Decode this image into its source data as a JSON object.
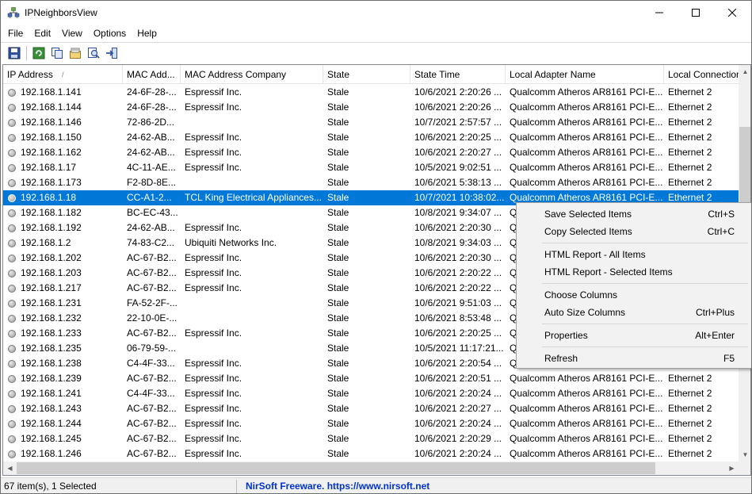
{
  "window": {
    "title": "IPNeighborsView"
  },
  "menu": [
    "File",
    "Edit",
    "View",
    "Options",
    "Help"
  ],
  "toolbar": {
    "buttons": [
      "save-icon",
      "refresh-icon",
      "copy-icon",
      "properties-icon",
      "find-icon",
      "exit-icon"
    ]
  },
  "columns": [
    "IP Address",
    "MAC Add...",
    "MAC Address Company",
    "State",
    "State Time",
    "Local Adapter Name",
    "Local Connection"
  ],
  "sort_indicator": "/",
  "rows": [
    {
      "ip": "192.168.1.141",
      "mac": "24-6F-28-...",
      "company": "Espressif Inc.",
      "state": "Stale",
      "time": "10/6/2021 2:20:26 ...",
      "adapter": "Qualcomm Atheros AR8161 PCI-E...",
      "conn": "Ethernet 2"
    },
    {
      "ip": "192.168.1.144",
      "mac": "24-6F-28-...",
      "company": "Espressif Inc.",
      "state": "Stale",
      "time": "10/6/2021 2:20:26 ...",
      "adapter": "Qualcomm Atheros AR8161 PCI-E...",
      "conn": "Ethernet 2"
    },
    {
      "ip": "192.168.1.146",
      "mac": "72-86-2D...",
      "company": "",
      "state": "Stale",
      "time": "10/7/2021 2:57:57 ...",
      "adapter": "Qualcomm Atheros AR8161 PCI-E...",
      "conn": "Ethernet 2"
    },
    {
      "ip": "192.168.1.150",
      "mac": "24-62-AB...",
      "company": "Espressif Inc.",
      "state": "Stale",
      "time": "10/6/2021 2:20:25 ...",
      "adapter": "Qualcomm Atheros AR8161 PCI-E...",
      "conn": "Ethernet 2"
    },
    {
      "ip": "192.168.1.162",
      "mac": "24-62-AB...",
      "company": "Espressif Inc.",
      "state": "Stale",
      "time": "10/6/2021 2:20:27 ...",
      "adapter": "Qualcomm Atheros AR8161 PCI-E...",
      "conn": "Ethernet 2"
    },
    {
      "ip": "192.168.1.17",
      "mac": "4C-11-AE...",
      "company": "Espressif Inc.",
      "state": "Stale",
      "time": "10/5/2021 9:02:51 ...",
      "adapter": "Qualcomm Atheros AR8161 PCI-E...",
      "conn": "Ethernet 2"
    },
    {
      "ip": "192.168.1.173",
      "mac": "F2-8D-8E...",
      "company": "",
      "state": "Stale",
      "time": "10/6/2021 5:38:13 ...",
      "adapter": "Qualcomm Atheros AR8161 PCI-E...",
      "conn": "Ethernet 2"
    },
    {
      "ip": "192.168.1.18",
      "mac": "CC-A1-2...",
      "company": "TCL King Electrical Appliances...",
      "state": "Stale",
      "time": "10/7/2021 10:38:02...",
      "adapter": "Qualcomm Atheros AR8161 PCI-E...",
      "conn": "Ethernet 2",
      "selected": true
    },
    {
      "ip": "192.168.1.182",
      "mac": "BC-EC-43...",
      "company": "",
      "state": "Stale",
      "time": "10/8/2021 9:34:07 ...",
      "adapter": "Q",
      "conn": ""
    },
    {
      "ip": "192.168.1.192",
      "mac": "24-62-AB...",
      "company": "Espressif Inc.",
      "state": "Stale",
      "time": "10/6/2021 2:20:30 ...",
      "adapter": "Q",
      "conn": ""
    },
    {
      "ip": "192.168.1.2",
      "mac": "74-83-C2...",
      "company": "Ubiquiti Networks Inc.",
      "state": "Stale",
      "time": "10/8/2021 9:34:03 ...",
      "adapter": "Q",
      "conn": ""
    },
    {
      "ip": "192.168.1.202",
      "mac": "AC-67-B2...",
      "company": "Espressif Inc.",
      "state": "Stale",
      "time": "10/6/2021 2:20:30 ...",
      "adapter": "Q",
      "conn": ""
    },
    {
      "ip": "192.168.1.203",
      "mac": "AC-67-B2...",
      "company": "Espressif Inc.",
      "state": "Stale",
      "time": "10/6/2021 2:20:22 ...",
      "adapter": "Q",
      "conn": ""
    },
    {
      "ip": "192.168.1.217",
      "mac": "AC-67-B2...",
      "company": "Espressif Inc.",
      "state": "Stale",
      "time": "10/6/2021 2:20:22 ...",
      "adapter": "Q",
      "conn": ""
    },
    {
      "ip": "192.168.1.231",
      "mac": "FA-52-2F-...",
      "company": "",
      "state": "Stale",
      "time": "10/6/2021 9:51:03 ...",
      "adapter": "Q",
      "conn": ""
    },
    {
      "ip": "192.168.1.232",
      "mac": "22-10-0E-...",
      "company": "",
      "state": "Stale",
      "time": "10/6/2021 8:53:48 ...",
      "adapter": "Q",
      "conn": ""
    },
    {
      "ip": "192.168.1.233",
      "mac": "AC-67-B2...",
      "company": "Espressif Inc.",
      "state": "Stale",
      "time": "10/6/2021 2:20:25 ...",
      "adapter": "Q",
      "conn": ""
    },
    {
      "ip": "192.168.1.235",
      "mac": "06-79-59-...",
      "company": "",
      "state": "Stale",
      "time": "10/5/2021 11:17:21...",
      "adapter": "Q",
      "conn": ""
    },
    {
      "ip": "192.168.1.238",
      "mac": "C4-4F-33...",
      "company": "Espressif Inc.",
      "state": "Stale",
      "time": "10/6/2021 2:20:54 ...",
      "adapter": "Q",
      "conn": ""
    },
    {
      "ip": "192.168.1.239",
      "mac": "AC-67-B2...",
      "company": "Espressif Inc.",
      "state": "Stale",
      "time": "10/6/2021 2:20:51 ...",
      "adapter": "Qualcomm Atheros AR8161 PCI-E...",
      "conn": "Ethernet 2"
    },
    {
      "ip": "192.168.1.241",
      "mac": "C4-4F-33...",
      "company": "Espressif Inc.",
      "state": "Stale",
      "time": "10/6/2021 2:20:24 ...",
      "adapter": "Qualcomm Atheros AR8161 PCI-E...",
      "conn": "Ethernet 2"
    },
    {
      "ip": "192.168.1.243",
      "mac": "AC-67-B2...",
      "company": "Espressif Inc.",
      "state": "Stale",
      "time": "10/6/2021 2:20:27 ...",
      "adapter": "Qualcomm Atheros AR8161 PCI-E...",
      "conn": "Ethernet 2"
    },
    {
      "ip": "192.168.1.244",
      "mac": "AC-67-B2...",
      "company": "Espressif Inc.",
      "state": "Stale",
      "time": "10/6/2021 2:20:24 ...",
      "adapter": "Qualcomm Atheros AR8161 PCI-E...",
      "conn": "Ethernet 2"
    },
    {
      "ip": "192.168.1.245",
      "mac": "AC-67-B2...",
      "company": "Espressif Inc.",
      "state": "Stale",
      "time": "10/6/2021 2:20:29 ...",
      "adapter": "Qualcomm Atheros AR8161 PCI-E...",
      "conn": "Ethernet 2"
    },
    {
      "ip": "192.168.1.246",
      "mac": "AC-67-B2...",
      "company": "Espressif Inc.",
      "state": "Stale",
      "time": "10/6/2021 2:20:24 ...",
      "adapter": "Qualcomm Atheros AR8161 PCI-E...",
      "conn": "Ethernet 2"
    }
  ],
  "context_menu": {
    "groups": [
      [
        {
          "label": "Save Selected Items",
          "shortcut": "Ctrl+S"
        },
        {
          "label": "Copy Selected Items",
          "shortcut": "Ctrl+C"
        }
      ],
      [
        {
          "label": "HTML Report - All Items",
          "shortcut": ""
        },
        {
          "label": "HTML Report - Selected Items",
          "shortcut": ""
        }
      ],
      [
        {
          "label": "Choose Columns",
          "shortcut": ""
        },
        {
          "label": "Auto Size Columns",
          "shortcut": "Ctrl+Plus"
        }
      ],
      [
        {
          "label": "Properties",
          "shortcut": "Alt+Enter"
        }
      ],
      [
        {
          "label": "Refresh",
          "shortcut": "F5"
        }
      ]
    ]
  },
  "status": {
    "count": "67 item(s), 1 Selected",
    "link": "NirSoft Freeware. https://www.nirsoft.net"
  },
  "colors": {
    "selection": "#0078d7",
    "link": "#0033cc"
  }
}
